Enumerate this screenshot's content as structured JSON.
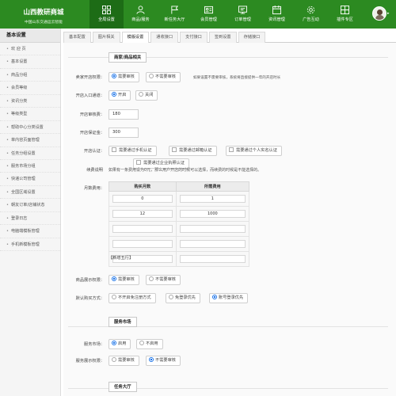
{
  "header": {
    "brand_name": "山西教研商城",
    "brand_sub": "中国山东交通运云智能",
    "nav": [
      {
        "label": "全局设置",
        "icon": "grid-icon",
        "active": true
      },
      {
        "label": "商品/服务",
        "icon": "user-icon",
        "active": false
      },
      {
        "label": "新任务大厅",
        "icon": "flag-icon",
        "active": false
      },
      {
        "label": "会员管理",
        "icon": "id-card-icon",
        "active": false
      },
      {
        "label": "订单管理",
        "icon": "order-icon",
        "active": false
      },
      {
        "label": "资讯管理",
        "icon": "calendar-icon",
        "active": false
      },
      {
        "label": "广告互动",
        "icon": "gear-icon",
        "active": false
      },
      {
        "label": "插件专区",
        "icon": "plugin-icon",
        "active": false
      }
    ],
    "user_arrow": "▸"
  },
  "sidebar": {
    "title": "基本设置",
    "items": [
      "欢 迎 页",
      "基本设置",
      "商品分组",
      "会员等级",
      "资讯分类",
      "等级类型",
      "帮助中心分类设置",
      "单内容页面管理",
      "任务分组设置",
      "服务市场分组",
      "快递公司管理",
      "全国区域设置",
      "朝友订单/店铺状态",
      "登录日志",
      "电脑端模板管理",
      "手机新模板管理"
    ]
  },
  "tabs": [
    "基本配置",
    "图片相关",
    "模版设置",
    "通收接口",
    "支付接口",
    "签到设置",
    "存储接口"
  ],
  "active_tab": 2,
  "shop": {
    "section_title": "商家/商品相关",
    "open_label": "卖家开店权限：",
    "open_options": [
      "需要审核",
      "不需要审核"
    ],
    "open_note": "如果设置不需要审核，系统将直接提供一年的开店时长",
    "channel_label": "开店入口通道：",
    "channel_options": [
      "开启",
      "关闭"
    ],
    "audit_fee_label": "开店审核费：",
    "audit_fee_value": "180",
    "deposit_label": "开店保证金：",
    "deposit_value": "300",
    "auth_label": "开店认证：",
    "auth_options": [
      "需要通过手机认证",
      "需要通过邮箱认证",
      "需要通过个人实名认证",
      "需要通过企业执照认证"
    ],
    "fee_desc_label": "续费说明",
    "fee_desc_text": "如果有一条费用设为0元，那么用户开店的时候可以选择，而续费的时候是不能选择的。",
    "month_fee_label": "月数费用：",
    "table_headers": [
      "购买月数",
      "所需费用"
    ],
    "table_rows": [
      [
        "0",
        "1"
      ],
      [
        "12",
        "1000"
      ],
      [
        "",
        ""
      ],
      [
        "",
        ""
      ],
      [
        "",
        ""
      ]
    ],
    "add_rows": "【新增五行】",
    "show_label": "商品展示权限：",
    "show_options": [
      "需要审核",
      "不需要审核"
    ],
    "buy_label": "默认购买方式：",
    "buy_options": [
      "不开启免注册方式",
      "免登录优先",
      "账号登录优先"
    ]
  },
  "market": {
    "section_title": "服务市场",
    "market_label": "服务市场：",
    "market_options": [
      "启用",
      "不启用"
    ],
    "show_label": "服务展示权限：",
    "show_options": [
      "需要审核",
      "不需要审核"
    ]
  },
  "task": {
    "section_title": "任务大厅"
  }
}
